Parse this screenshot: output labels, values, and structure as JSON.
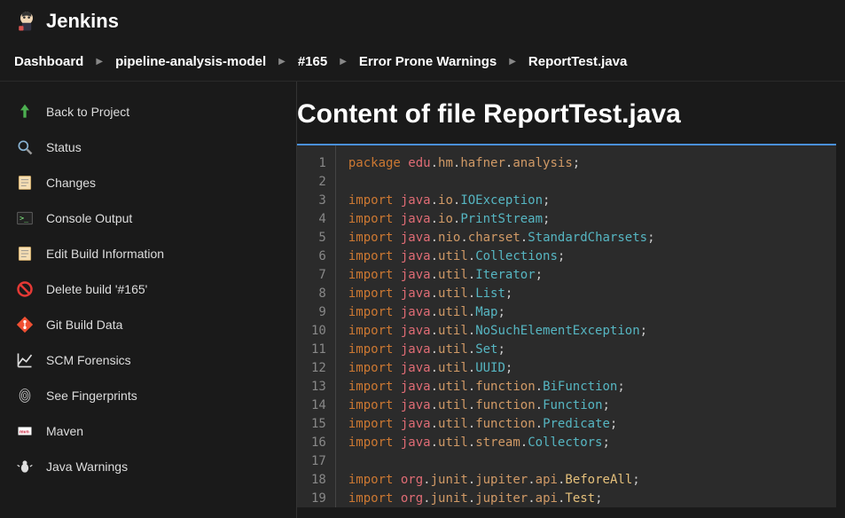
{
  "header": {
    "brand": "Jenkins"
  },
  "breadcrumb": [
    "Dashboard",
    "pipeline-analysis-model",
    "#165",
    "Error Prone Warnings",
    "ReportTest.java"
  ],
  "sidebar": [
    {
      "name": "back",
      "icon": "arrow-up",
      "label": "Back to Project"
    },
    {
      "name": "status",
      "icon": "magnify",
      "label": "Status"
    },
    {
      "name": "changes",
      "icon": "notepad",
      "label": "Changes"
    },
    {
      "name": "console",
      "icon": "terminal",
      "label": "Console Output"
    },
    {
      "name": "edit",
      "icon": "notepad",
      "label": "Edit Build Information"
    },
    {
      "name": "delete",
      "icon": "no",
      "label": "Delete build '#165'"
    },
    {
      "name": "git",
      "icon": "git",
      "label": "Git Build Data"
    },
    {
      "name": "scm",
      "icon": "chart",
      "label": "SCM Forensics"
    },
    {
      "name": "finger",
      "icon": "finger",
      "label": "See Fingerprints"
    },
    {
      "name": "maven",
      "icon": "maven",
      "label": "Maven"
    },
    {
      "name": "warn",
      "icon": "bug",
      "label": "Java Warnings"
    }
  ],
  "main": {
    "title": "Content of file ReportTest.java"
  },
  "code": [
    [
      {
        "t": "package ",
        "c": "kw"
      },
      {
        "t": "edu",
        "c": "pkg"
      },
      {
        "t": ".",
        "c": "dot"
      },
      {
        "t": "hm",
        "c": "pkg2"
      },
      {
        "t": ".",
        "c": "dot"
      },
      {
        "t": "hafner",
        "c": "pkg2"
      },
      {
        "t": ".",
        "c": "dot"
      },
      {
        "t": "analysis",
        "c": "pkg2"
      },
      {
        "t": ";",
        "c": "semi"
      }
    ],
    [],
    [
      {
        "t": "import ",
        "c": "kw"
      },
      {
        "t": "java",
        "c": "pkg"
      },
      {
        "t": ".",
        "c": "dot"
      },
      {
        "t": "io",
        "c": "pkg2"
      },
      {
        "t": ".",
        "c": "dot"
      },
      {
        "t": "IOException",
        "c": "cls"
      },
      {
        "t": ";",
        "c": "semi"
      }
    ],
    [
      {
        "t": "import ",
        "c": "kw"
      },
      {
        "t": "java",
        "c": "pkg"
      },
      {
        "t": ".",
        "c": "dot"
      },
      {
        "t": "io",
        "c": "pkg2"
      },
      {
        "t": ".",
        "c": "dot"
      },
      {
        "t": "PrintStream",
        "c": "cls"
      },
      {
        "t": ";",
        "c": "semi"
      }
    ],
    [
      {
        "t": "import ",
        "c": "kw"
      },
      {
        "t": "java",
        "c": "pkg"
      },
      {
        "t": ".",
        "c": "dot"
      },
      {
        "t": "nio",
        "c": "pkg2"
      },
      {
        "t": ".",
        "c": "dot"
      },
      {
        "t": "charset",
        "c": "pkg2"
      },
      {
        "t": ".",
        "c": "dot"
      },
      {
        "t": "StandardCharsets",
        "c": "cls"
      },
      {
        "t": ";",
        "c": "semi"
      }
    ],
    [
      {
        "t": "import ",
        "c": "kw"
      },
      {
        "t": "java",
        "c": "pkg"
      },
      {
        "t": ".",
        "c": "dot"
      },
      {
        "t": "util",
        "c": "pkg2"
      },
      {
        "t": ".",
        "c": "dot"
      },
      {
        "t": "Collections",
        "c": "cls"
      },
      {
        "t": ";",
        "c": "semi"
      }
    ],
    [
      {
        "t": "import ",
        "c": "kw"
      },
      {
        "t": "java",
        "c": "pkg"
      },
      {
        "t": ".",
        "c": "dot"
      },
      {
        "t": "util",
        "c": "pkg2"
      },
      {
        "t": ".",
        "c": "dot"
      },
      {
        "t": "Iterator",
        "c": "cls"
      },
      {
        "t": ";",
        "c": "semi"
      }
    ],
    [
      {
        "t": "import ",
        "c": "kw"
      },
      {
        "t": "java",
        "c": "pkg"
      },
      {
        "t": ".",
        "c": "dot"
      },
      {
        "t": "util",
        "c": "pkg2"
      },
      {
        "t": ".",
        "c": "dot"
      },
      {
        "t": "List",
        "c": "cls"
      },
      {
        "t": ";",
        "c": "semi"
      }
    ],
    [
      {
        "t": "import ",
        "c": "kw"
      },
      {
        "t": "java",
        "c": "pkg"
      },
      {
        "t": ".",
        "c": "dot"
      },
      {
        "t": "util",
        "c": "pkg2"
      },
      {
        "t": ".",
        "c": "dot"
      },
      {
        "t": "Map",
        "c": "cls"
      },
      {
        "t": ";",
        "c": "semi"
      }
    ],
    [
      {
        "t": "import ",
        "c": "kw"
      },
      {
        "t": "java",
        "c": "pkg"
      },
      {
        "t": ".",
        "c": "dot"
      },
      {
        "t": "util",
        "c": "pkg2"
      },
      {
        "t": ".",
        "c": "dot"
      },
      {
        "t": "NoSuchElementException",
        "c": "cls"
      },
      {
        "t": ";",
        "c": "semi"
      }
    ],
    [
      {
        "t": "import ",
        "c": "kw"
      },
      {
        "t": "java",
        "c": "pkg"
      },
      {
        "t": ".",
        "c": "dot"
      },
      {
        "t": "util",
        "c": "pkg2"
      },
      {
        "t": ".",
        "c": "dot"
      },
      {
        "t": "Set",
        "c": "cls"
      },
      {
        "t": ";",
        "c": "semi"
      }
    ],
    [
      {
        "t": "import ",
        "c": "kw"
      },
      {
        "t": "java",
        "c": "pkg"
      },
      {
        "t": ".",
        "c": "dot"
      },
      {
        "t": "util",
        "c": "pkg2"
      },
      {
        "t": ".",
        "c": "dot"
      },
      {
        "t": "UUID",
        "c": "cls"
      },
      {
        "t": ";",
        "c": "semi"
      }
    ],
    [
      {
        "t": "import ",
        "c": "kw"
      },
      {
        "t": "java",
        "c": "pkg"
      },
      {
        "t": ".",
        "c": "dot"
      },
      {
        "t": "util",
        "c": "pkg2"
      },
      {
        "t": ".",
        "c": "dot"
      },
      {
        "t": "function",
        "c": "pkg2"
      },
      {
        "t": ".",
        "c": "dot"
      },
      {
        "t": "BiFunction",
        "c": "cls"
      },
      {
        "t": ";",
        "c": "semi"
      }
    ],
    [
      {
        "t": "import ",
        "c": "kw"
      },
      {
        "t": "java",
        "c": "pkg"
      },
      {
        "t": ".",
        "c": "dot"
      },
      {
        "t": "util",
        "c": "pkg2"
      },
      {
        "t": ".",
        "c": "dot"
      },
      {
        "t": "function",
        "c": "pkg2"
      },
      {
        "t": ".",
        "c": "dot"
      },
      {
        "t": "Function",
        "c": "cls"
      },
      {
        "t": ";",
        "c": "semi"
      }
    ],
    [
      {
        "t": "import ",
        "c": "kw"
      },
      {
        "t": "java",
        "c": "pkg"
      },
      {
        "t": ".",
        "c": "dot"
      },
      {
        "t": "util",
        "c": "pkg2"
      },
      {
        "t": ".",
        "c": "dot"
      },
      {
        "t": "function",
        "c": "pkg2"
      },
      {
        "t": ".",
        "c": "dot"
      },
      {
        "t": "Predicate",
        "c": "cls"
      },
      {
        "t": ";",
        "c": "semi"
      }
    ],
    [
      {
        "t": "import ",
        "c": "kw"
      },
      {
        "t": "java",
        "c": "pkg"
      },
      {
        "t": ".",
        "c": "dot"
      },
      {
        "t": "util",
        "c": "pkg2"
      },
      {
        "t": ".",
        "c": "dot"
      },
      {
        "t": "stream",
        "c": "pkg2"
      },
      {
        "t": ".",
        "c": "dot"
      },
      {
        "t": "Collectors",
        "c": "cls"
      },
      {
        "t": ";",
        "c": "semi"
      }
    ],
    [],
    [
      {
        "t": "import ",
        "c": "kw"
      },
      {
        "t": "org",
        "c": "pkg"
      },
      {
        "t": ".",
        "c": "dot"
      },
      {
        "t": "junit",
        "c": "pkg2"
      },
      {
        "t": ".",
        "c": "dot"
      },
      {
        "t": "jupiter",
        "c": "pkg2"
      },
      {
        "t": ".",
        "c": "dot"
      },
      {
        "t": "api",
        "c": "pkg2"
      },
      {
        "t": ".",
        "c": "dot"
      },
      {
        "t": "BeforeAll",
        "c": "cls2"
      },
      {
        "t": ";",
        "c": "semi"
      }
    ],
    [
      {
        "t": "import ",
        "c": "kw"
      },
      {
        "t": "org",
        "c": "pkg"
      },
      {
        "t": ".",
        "c": "dot"
      },
      {
        "t": "junit",
        "c": "pkg2"
      },
      {
        "t": ".",
        "c": "dot"
      },
      {
        "t": "jupiter",
        "c": "pkg2"
      },
      {
        "t": ".",
        "c": "dot"
      },
      {
        "t": "api",
        "c": "pkg2"
      },
      {
        "t": ".",
        "c": "dot"
      },
      {
        "t": "Test",
        "c": "cls2"
      },
      {
        "t": ";",
        "c": "semi"
      }
    ]
  ],
  "icons": {
    "arrow-up": "<svg viewBox='0 0 24 24' width='20' height='20'><path fill='#4caf50' d='M12 2l6 8h-4v10h-4V10H6z'/></svg>",
    "magnify": "<svg viewBox='0 0 24 24' width='20' height='20'><circle cx='10' cy='10' r='6' fill='none' stroke='#89b4d4' stroke-width='2'/><line x1='15' y1='15' x2='21' y2='21' stroke='#999' stroke-width='3'/></svg>",
    "notepad": "<svg viewBox='0 0 24 24' width='20' height='20'><rect x='4' y='3' width='16' height='18' rx='1' fill='#f5deb3' stroke='#c9a25d'/><line x1='7' y1='8' x2='17' y2='8' stroke='#888'/><line x1='7' y1='12' x2='17' y2='12' stroke='#888'/><line x1='7' y1='16' x2='14' y2='16' stroke='#888'/></svg>",
    "terminal": "<svg viewBox='0 0 24 24' width='20' height='20'><rect x='2' y='4' width='20' height='16' rx='1' fill='#222' stroke='#666'/><text x='5' y='15' fill='#8f8' font-size='10' font-family='monospace'>&gt;_</text></svg>",
    "no": "<svg viewBox='0 0 24 24' width='20' height='20'><circle cx='12' cy='12' r='9' fill='none' stroke='#e53935' stroke-width='3'/><line x1='6' y1='6' x2='18' y2='18' stroke='#e53935' stroke-width='3'/></svg>",
    "git": "<svg viewBox='0 0 24 24' width='20' height='20'><path fill='#f05033' d='M12 1l11 11-11 11L1 12z'/><circle cx='12' cy='8' r='2' fill='#fff'/><circle cx='12' cy='16' r='2' fill='#fff'/><line x1='12' y1='8' x2='12' y2='16' stroke='#fff' stroke-width='1.5'/></svg>",
    "chart": "<svg viewBox='0 0 24 24' width='20' height='20'><polyline points='3,18 9,10 14,14 21,5' fill='none' stroke='#ddd' stroke-width='2'/><line x1='3' y1='21' x2='21' y2='21' stroke='#ddd' stroke-width='2'/><line x1='3' y1='3' x2='3' y2='21' stroke='#ddd' stroke-width='2'/></svg>",
    "finger": "<svg viewBox='0 0 24 24' width='20' height='20'><ellipse cx='12' cy='12' rx='7' ry='9' fill='none' stroke='#ccc' stroke-width='1'/><ellipse cx='12' cy='12' rx='4.5' ry='6' fill='none' stroke='#ccc' stroke-width='1'/><ellipse cx='12' cy='12' rx='2' ry='3' fill='none' stroke='#ccc' stroke-width='1'/></svg>",
    "maven": "<svg viewBox='0 0 24 24' width='18' height='18'><rect x='2' y='6' width='20' height='12' fill='#fff'/><text x='4' y='15' fill='#c71a36' font-size='7' font-family='Arial' font-weight='bold'>mvn</text></svg>",
    "bug": "<svg viewBox='0 0 24 24' width='20' height='20'><ellipse cx='12' cy='14' rx='5' ry='6' fill='#ddd'/><circle cx='12' cy='7' r='3' fill='#ddd'/><line x1='5' y1='12' x2='2' y2='10' stroke='#ddd' stroke-width='1.5'/><line x1='19' y1='12' x2='22' y2='10' stroke='#ddd' stroke-width='1.5'/></svg>",
    "jenkins": "<svg viewBox='0 0 32 32' width='28' height='28'><circle cx='16' cy='12' r='8' fill='#f0d6b5'/><rect x='10' y='18' width='12' height='10' fill='#334' rx='2'/><circle cx='13' cy='11' r='1.5' fill='#333'/><circle cx='19' cy='11' r='1.5' fill='#333'/><path d='M10 6 Q16 2 22 6 L22 10 Q16 7 10 10 Z' fill='#333'/><rect x='6' y='22' width='6' height='6' fill='#d9534f' rx='1'/></svg>"
  }
}
